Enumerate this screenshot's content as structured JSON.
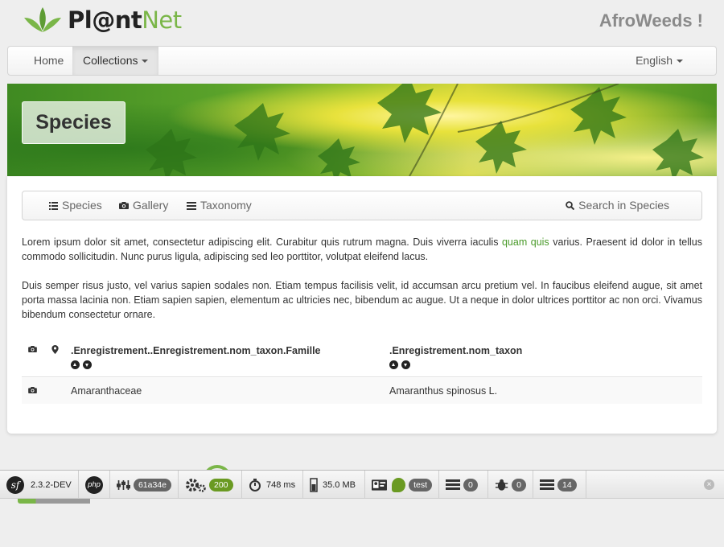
{
  "header": {
    "logo_main": "Pl@nt",
    "logo_accent": "Net",
    "site_title": "AfroWeeds !"
  },
  "navbar": {
    "home": "Home",
    "collections": "Collections",
    "language": "English"
  },
  "banner": {
    "title": "Species"
  },
  "subnav": {
    "species": "Species",
    "gallery": "Gallery",
    "taxonomy": "Taxonomy",
    "search": "Search in Species"
  },
  "content": {
    "p1_before": "Lorem ipsum dolor sit amet, consectetur adipiscing elit. Curabitur quis rutrum magna. Duis viverra iaculis ",
    "p1_link": "quam quis",
    "p1_after": " varius. Praesent id dolor in tellus commodo sollicitudin. Nunc purus ligula, adipiscing sed leo porttitor, volutpat eleifend lacus.",
    "p2": "Duis semper risus justo, vel varius sapien sodales non. Etiam tempus facilisis velit, id accumsan arcu pretium vel. In faucibus eleifend augue, sit amet porta massa lacinia non. Etiam sapien sapien, elementum ac ultricies nec, bibendum ac augue. Ut a neque in dolor ultrices porttitor ac non orci. Vivamus bibendum consectetur ornare."
  },
  "table": {
    "columns": [
      ".Enregistrement..Enregistrement.nom_taxon.Famille",
      ".Enregistrement.nom_taxon"
    ],
    "rows": [
      {
        "famille": "Amaranthaceae",
        "taxon": "Amaranthus spinosus L."
      }
    ]
  },
  "debug_toolbar": {
    "version": "2.3.2-DEV",
    "php": "php",
    "token": "61a34e",
    "status": "200",
    "time": "748 ms",
    "memory": "35.0 MB",
    "env": "test",
    "count_a": "0",
    "count_b": "0",
    "count_c": "14",
    "colors": {
      "status_ok": "#6a9a22",
      "badge": "#666666"
    }
  },
  "colors": {
    "accent": "#7ab648",
    "link": "#4a9a2a"
  }
}
